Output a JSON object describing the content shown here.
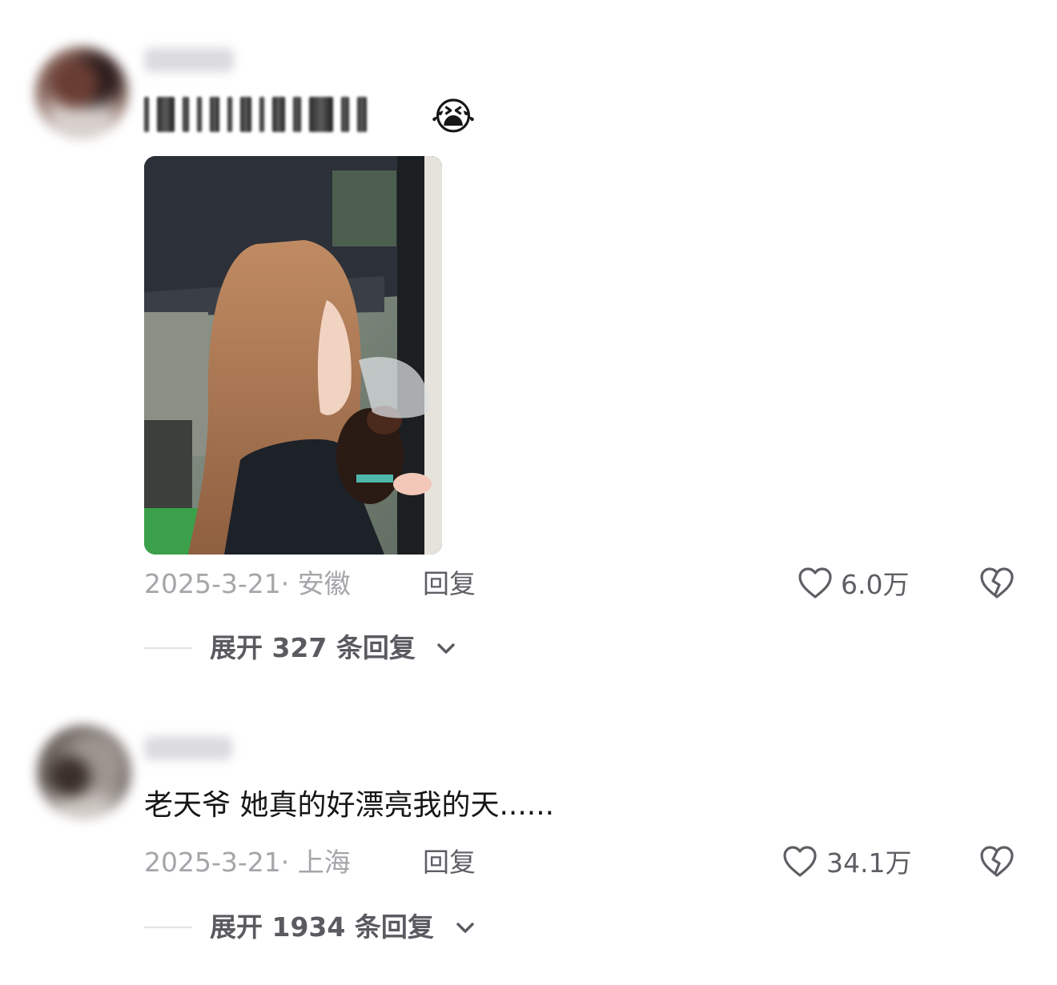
{
  "comments": [
    {
      "date_location": "2025-3-21· 安徽",
      "reply_label": "回复",
      "like_count": "6.0万",
      "expand_label": "展开 327 条回复"
    },
    {
      "text": "老天爷 她真的好漂亮我的天......",
      "date_location": "2025-3-21· 上海",
      "reply_label": "回复",
      "like_count": "34.1万",
      "expand_label": "展开 1934 条回复"
    }
  ],
  "icons": {
    "emoji": "crying-face",
    "like": "heart-outline-icon",
    "dislike": "broken-heart-icon",
    "expand": "chevron-down-icon"
  }
}
